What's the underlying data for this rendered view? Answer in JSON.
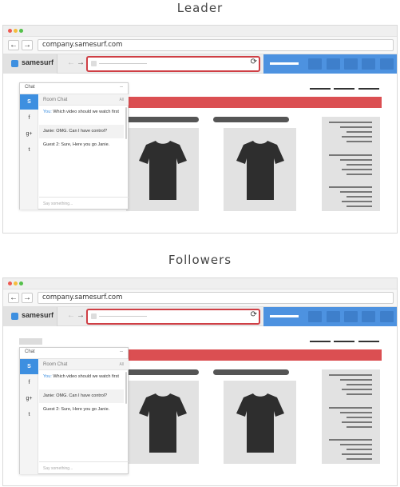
{
  "sections": [
    {
      "title": "Leader"
    },
    {
      "title": "Followers"
    }
  ],
  "browser": {
    "url": "company.samesurf.com",
    "back_icon": "←",
    "forward_icon": "→"
  },
  "extension": {
    "brand_name": "samesurf",
    "back_icon": "←",
    "forward_icon": "→",
    "reload_icon": "⟳",
    "accent_color": "#4d92e0",
    "highlight_color": "#cf3f45"
  },
  "chat": {
    "title": "Chat",
    "minimize_icon": "–",
    "rail": [
      "S",
      "f",
      "g+",
      "t"
    ],
    "room_label": "Room Chat",
    "filter_label": "All",
    "messages": [
      {
        "author": "You:",
        "text": "Which video should we watch first"
      },
      {
        "author": "Janie:",
        "text": "OMG. Can I have control?"
      },
      {
        "author": "Guest 2:",
        "text": "Sure, Here you go Janie."
      }
    ],
    "input_placeholder": "Say something..."
  },
  "colors": {
    "banner": "#db4f52",
    "chat_active": "#3d8fe0"
  }
}
